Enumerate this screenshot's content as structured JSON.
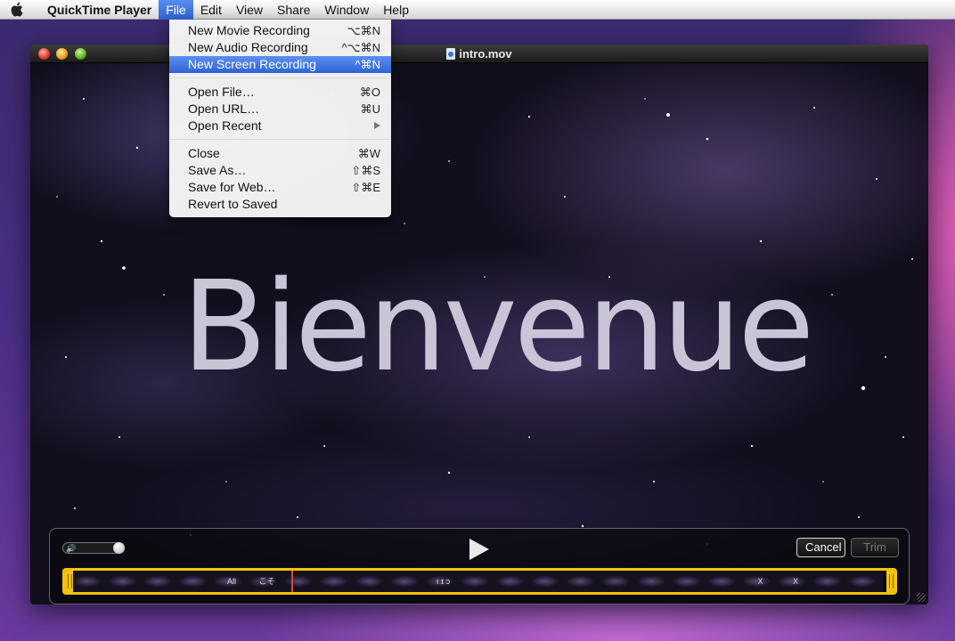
{
  "menubar": {
    "apple_icon": "apple-logo-icon",
    "app_name": "QuickTime Player",
    "menus": [
      "File",
      "Edit",
      "View",
      "Share",
      "Window",
      "Help"
    ],
    "active_menu": "File"
  },
  "file_menu": {
    "groups": [
      [
        {
          "label": "New Movie Recording",
          "shortcut": "⌥⌘N"
        },
        {
          "label": "New Audio Recording",
          "shortcut": "^⌥⌘N"
        },
        {
          "label": "New Screen Recording",
          "shortcut": "^⌘N",
          "highlighted": true
        }
      ],
      [
        {
          "label": "Open File…",
          "shortcut": "⌘O"
        },
        {
          "label": "Open URL…",
          "shortcut": "⌘U"
        },
        {
          "label": "Open Recent",
          "submenu": true
        }
      ],
      [
        {
          "label": "Close",
          "shortcut": "⌘W"
        },
        {
          "label": "Save As…",
          "shortcut": "⇧⌘S"
        },
        {
          "label": "Save for Web…",
          "shortcut": "⇧⌘E"
        },
        {
          "label": "Revert to Saved",
          "shortcut": ""
        }
      ]
    ]
  },
  "window": {
    "title": "intro.mov"
  },
  "video": {
    "overlay_text": "Bienvenue"
  },
  "controls": {
    "cancel_label": "Cancel",
    "trim_label": "Trim",
    "volume_icon": "speaker-icon",
    "play_icon": "play-icon",
    "filmstrip_frame_text": [
      "",
      "",
      "",
      "",
      "All genres",
      "こそ",
      "",
      "",
      "",
      "",
      "ı ɪ ɔ",
      "",
      "",
      "",
      "",
      "",
      "",
      "",
      "",
      "X",
      "X",
      "",
      ""
    ]
  },
  "colors": {
    "menu_highlight": "#3a6fd8",
    "trim_border": "#f4c20d",
    "playhead": "#d84a30"
  }
}
